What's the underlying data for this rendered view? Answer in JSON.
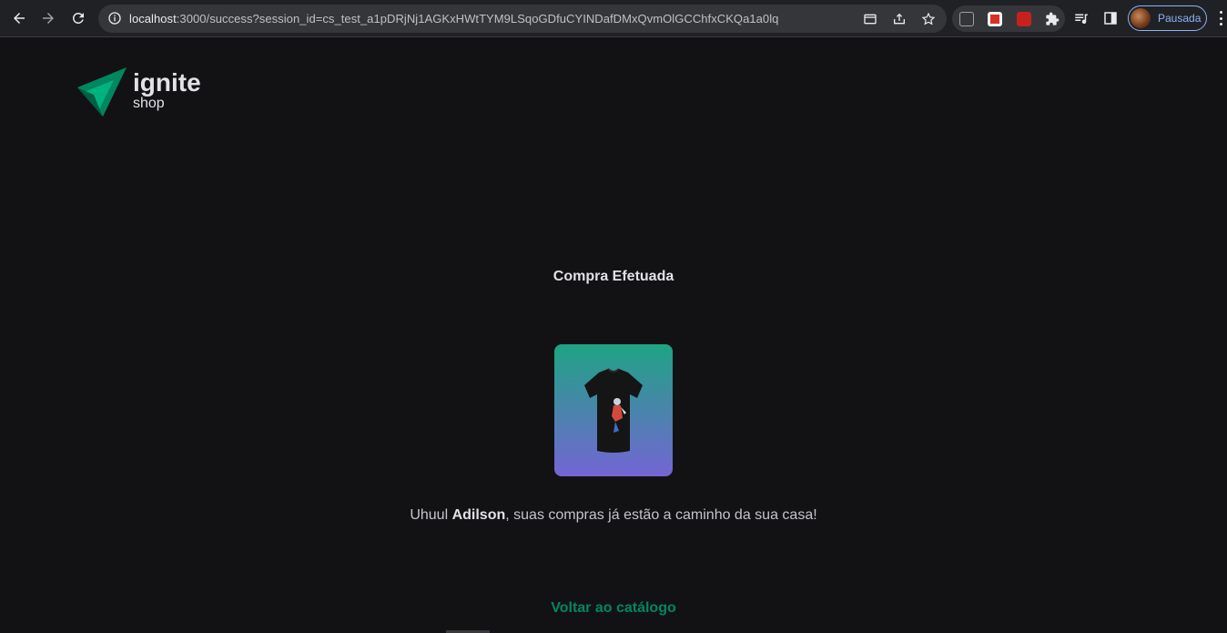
{
  "browser": {
    "url_host": "localhost",
    "url_rest": ":3000/success?session_id=cs_test_a1pDRjNj1AGKxHWtTYM9LSqoGDfuCYINDafDMxQvmOlGCChfxCKQa1a0lq",
    "profile_label": "Pausada"
  },
  "logo": {
    "title": "ignite",
    "subtitle": "shop",
    "colors": {
      "primary": "#00875f",
      "secondary": "#00b37e"
    }
  },
  "success": {
    "title": "Compra Efetuada",
    "message_prefix": "Uhuul ",
    "customer_name": "Adilson",
    "message_suffix": ", suas compras já estão a caminho da sua casa!",
    "back_link": "Voltar ao catálogo"
  },
  "colors": {
    "background": "#121214",
    "accent": "#00875f",
    "gradient_start": "#1ea483",
    "gradient_end": "#7465d4"
  }
}
